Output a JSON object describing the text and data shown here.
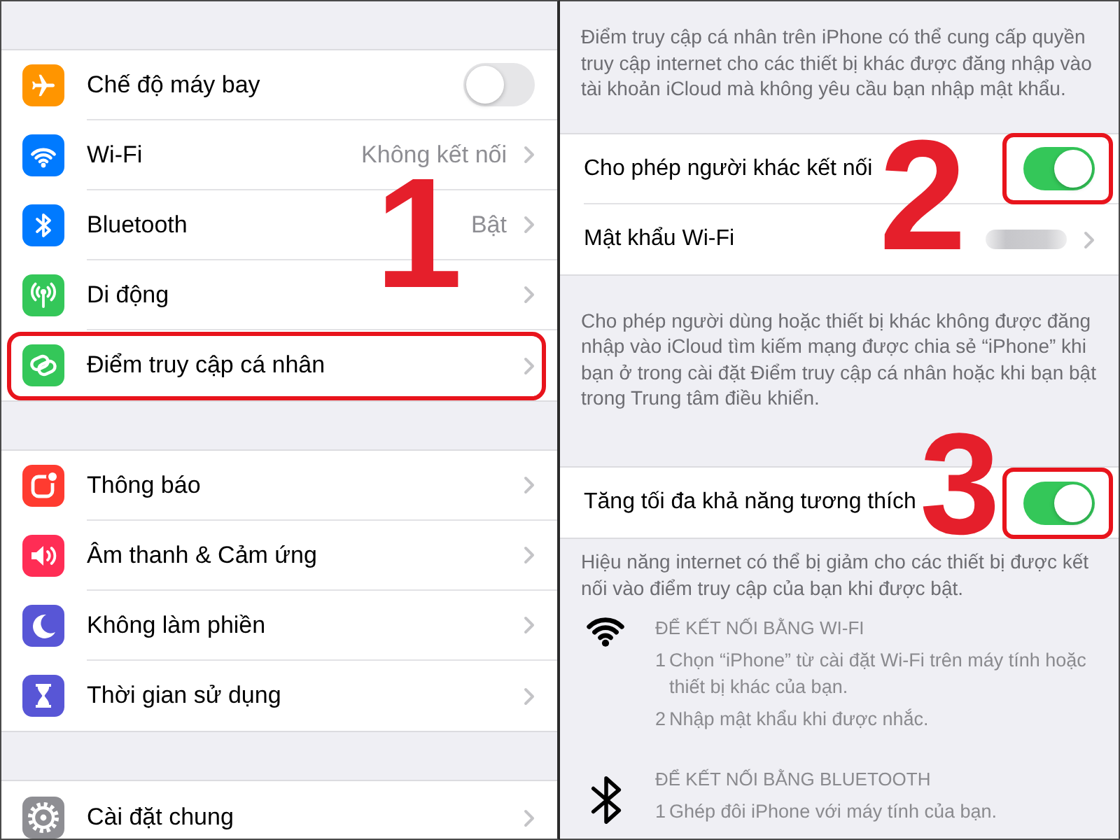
{
  "settings": {
    "groups": [
      {
        "rows": [
          {
            "label": "Chế độ máy bay",
            "kind": "toggle",
            "on": false,
            "highlighted": false
          },
          {
            "label": "Wi-Fi",
            "kind": "link",
            "value": "Không kết nối",
            "highlighted": false
          },
          {
            "label": "Bluetooth",
            "kind": "link",
            "value": "Bật",
            "highlighted": false
          },
          {
            "label": "Di động",
            "kind": "link",
            "highlighted": false
          },
          {
            "label": "Điểm truy cập cá nhân",
            "kind": "link",
            "highlighted": true
          }
        ]
      },
      {
        "rows": [
          {
            "label": "Thông báo",
            "kind": "link",
            "highlighted": false
          },
          {
            "label": "Âm thanh & Cảm ứng",
            "kind": "link",
            "highlighted": false
          },
          {
            "label": "Không làm phiền",
            "kind": "link",
            "highlighted": false
          },
          {
            "label": "Thời gian sử dụng",
            "kind": "link",
            "highlighted": false
          }
        ]
      },
      {
        "rows": [
          {
            "label": "Cài đặt chung",
            "kind": "link",
            "highlighted": false
          }
        ]
      }
    ]
  },
  "hotspot": {
    "sections": [
      {
        "kind": "note",
        "text": "Điểm truy cập cá nhân trên iPhone có thể cung cấp quyền truy cập internet cho các thiết bị khác được đăng nhập vào tài khoản iCloud mà không yêu cầu bạn nhập mật khẩu."
      },
      {
        "kind": "group",
        "rows": [
          {
            "label": "Cho phép người khác kết nối",
            "kind": "toggle",
            "on": true,
            "highlighted": true
          },
          {
            "label": "Mật khẩu Wi-Fi",
            "kind": "password",
            "highlighted": false
          }
        ]
      },
      {
        "kind": "note",
        "text": "Cho phép người dùng hoặc thiết bị khác không được đăng nhập vào iCloud tìm kiếm mạng được chia sẻ “iPhone” khi bạn ở trong cài đặt Điểm truy cập cá nhân hoặc khi bạn bật trong Trung tâm điều khiển."
      },
      {
        "kind": "group",
        "rows": [
          {
            "label": "Tăng tối đa khả năng tương thích",
            "kind": "toggle",
            "on": true,
            "highlighted": true
          }
        ]
      },
      {
        "kind": "note",
        "text": "Hiệu năng internet có thể bị giảm cho các thiết bị được kết nối vào điểm truy cập của bạn khi được bật."
      },
      {
        "kind": "instructions",
        "heading": "ĐỂ KẾT NỐI BẰNG WI-FI",
        "steps": [
          {
            "number": "1",
            "text": "Chọn “iPhone” từ cài đặt Wi-Fi trên máy tính hoặc thiết bị khác của bạn."
          },
          {
            "number": "2",
            "text": "Nhập mật khẩu khi được nhắc."
          }
        ]
      },
      {
        "kind": "instructions",
        "heading": "ĐỂ KẾT NỐI BẰNG BLUETOOTH",
        "steps": [
          {
            "number": "1",
            "text": "Ghép đôi iPhone với máy tính của bạn."
          }
        ]
      }
    ]
  },
  "callouts": [
    "1",
    "2",
    "3"
  ]
}
